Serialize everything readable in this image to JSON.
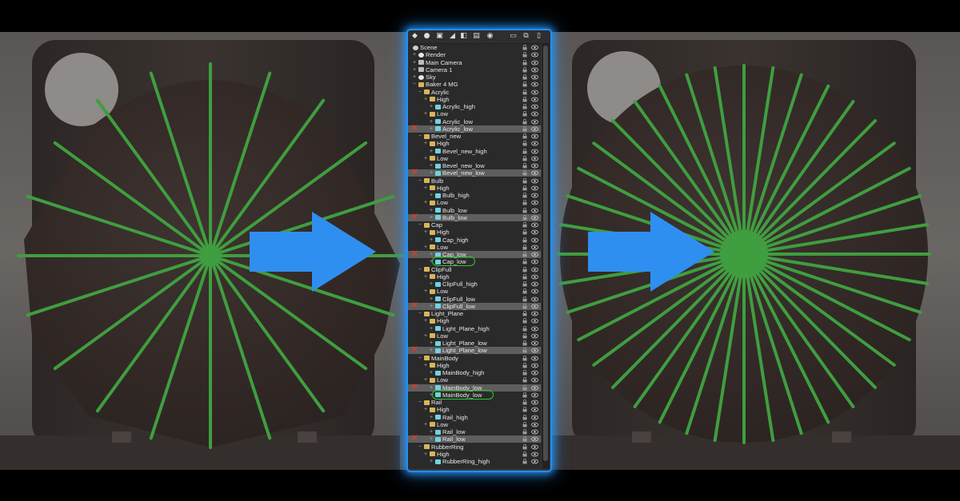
{
  "colors": {
    "spoke_green": "#3f9e3f",
    "arrow_blue": "#2f8ff0",
    "panel_glow": "#1e90ff",
    "highlight_row": "#5e5e5e",
    "error_mark": "#e03b2b",
    "circle_green": "#2dc62d"
  },
  "left_view": {
    "spoke_count": 20,
    "center": "single-point"
  },
  "right_view": {
    "spoke_count": 40,
    "center": "disc"
  },
  "toolbar_icons": [
    "object-icon",
    "light-icon",
    "camera-icon",
    "bake-icon",
    "material-icon",
    "texture-icon",
    "sky-icon",
    "folder-icon",
    "duplicate-icon",
    "trash-icon"
  ],
  "outliner": {
    "rows": [
      {
        "label": "Scene",
        "type": "scene",
        "level": 0,
        "expanded": true
      },
      {
        "label": "Render",
        "type": "light",
        "level": 1
      },
      {
        "label": "Main Camera",
        "type": "cam",
        "level": 1
      },
      {
        "label": "Camera 1",
        "type": "cam",
        "level": 1
      },
      {
        "label": "Sky",
        "type": "light",
        "level": 1
      },
      {
        "label": "Baker 4 MG",
        "type": "folder",
        "level": 1,
        "expanded": true
      },
      {
        "label": "Acrylic",
        "type": "folder",
        "level": 2,
        "expanded": true
      },
      {
        "label": "High",
        "type": "folder",
        "level": 3
      },
      {
        "label": "Acrylic_high",
        "type": "mesh",
        "level": 4
      },
      {
        "label": "Low",
        "type": "folder",
        "level": 3
      },
      {
        "label": "Acrylic_low",
        "type": "mesh",
        "level": 4
      },
      {
        "label": "Acrylic_low",
        "type": "mesh",
        "level": 4,
        "highlight": true,
        "error": true
      },
      {
        "label": "Bevel_new",
        "type": "folder",
        "level": 2,
        "expanded": true
      },
      {
        "label": "High",
        "type": "folder",
        "level": 3
      },
      {
        "label": "Bevel_new_high",
        "type": "mesh",
        "level": 4
      },
      {
        "label": "Low",
        "type": "folder",
        "level": 3
      },
      {
        "label": "Bevel_new_low",
        "type": "mesh",
        "level": 4
      },
      {
        "label": "Bevel_new_low",
        "type": "mesh",
        "level": 4,
        "highlight": true,
        "error": true
      },
      {
        "label": "Bulb",
        "type": "folder",
        "level": 2,
        "expanded": true
      },
      {
        "label": "High",
        "type": "folder",
        "level": 3
      },
      {
        "label": "Bulb_high",
        "type": "mesh",
        "level": 4
      },
      {
        "label": "Low",
        "type": "folder",
        "level": 3
      },
      {
        "label": "Bulb_low",
        "type": "mesh",
        "level": 4
      },
      {
        "label": "Bulb_low",
        "type": "mesh",
        "level": 4,
        "highlight": true,
        "error": true
      },
      {
        "label": "Cap",
        "type": "folder",
        "level": 2,
        "expanded": true
      },
      {
        "label": "High",
        "type": "folder",
        "level": 3
      },
      {
        "label": "Cap_high",
        "type": "mesh",
        "level": 4
      },
      {
        "label": "Low",
        "type": "folder",
        "level": 3
      },
      {
        "label": "Cap_low",
        "type": "mesh",
        "level": 4,
        "highlight": true,
        "error": true
      },
      {
        "label": "Cap_low",
        "type": "mesh",
        "level": 4,
        "circled": true
      },
      {
        "label": "ClipFull",
        "type": "folder",
        "level": 2,
        "expanded": true
      },
      {
        "label": "High",
        "type": "folder",
        "level": 3
      },
      {
        "label": "ClipFull_high",
        "type": "mesh",
        "level": 4
      },
      {
        "label": "Low",
        "type": "folder",
        "level": 3
      },
      {
        "label": "ClipFull_low",
        "type": "mesh",
        "level": 4
      },
      {
        "label": "ClipFull_low",
        "type": "mesh",
        "level": 4,
        "highlight": true,
        "error": true
      },
      {
        "label": "Light_Plane",
        "type": "folder",
        "level": 2,
        "expanded": true
      },
      {
        "label": "High",
        "type": "folder",
        "level": 3
      },
      {
        "label": "Light_Plane_high",
        "type": "mesh",
        "level": 4
      },
      {
        "label": "Low",
        "type": "folder",
        "level": 3
      },
      {
        "label": "Light_Plane_low",
        "type": "mesh",
        "level": 4
      },
      {
        "label": "Light_Plane_low",
        "type": "mesh",
        "level": 4,
        "highlight": true,
        "error": true
      },
      {
        "label": "MainBody",
        "type": "folder",
        "level": 2,
        "expanded": true
      },
      {
        "label": "High",
        "type": "folder",
        "level": 3
      },
      {
        "label": "MainBody_high",
        "type": "mesh",
        "level": 4
      },
      {
        "label": "Low",
        "type": "folder",
        "level": 3
      },
      {
        "label": "MainBody_low",
        "type": "mesh",
        "level": 4,
        "highlight": true,
        "error": true
      },
      {
        "label": "MainBody_low",
        "type": "mesh",
        "level": 4,
        "circled": true
      },
      {
        "label": "Rail",
        "type": "folder",
        "level": 2,
        "expanded": true
      },
      {
        "label": "High",
        "type": "folder",
        "level": 3
      },
      {
        "label": "Rail_high",
        "type": "mesh",
        "level": 4
      },
      {
        "label": "Low",
        "type": "folder",
        "level": 3
      },
      {
        "label": "Rail_low",
        "type": "mesh",
        "level": 4
      },
      {
        "label": "Rail_low",
        "type": "mesh",
        "level": 4,
        "highlight": true,
        "error": true
      },
      {
        "label": "RubberRing",
        "type": "folder",
        "level": 2,
        "expanded": true
      },
      {
        "label": "High",
        "type": "folder",
        "level": 3
      },
      {
        "label": "RubberRing_high",
        "type": "mesh",
        "level": 4
      }
    ]
  }
}
